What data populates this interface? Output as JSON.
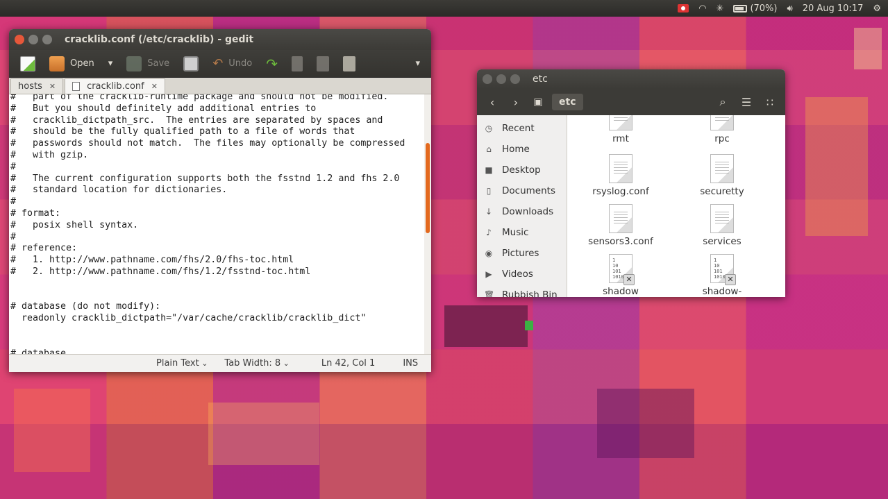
{
  "top_panel": {
    "battery": "(70%)",
    "datetime": "20 Aug 10:17"
  },
  "gedit": {
    "title": "cracklib.conf (/etc/cracklib) - gedit",
    "toolbar": {
      "open_label": "Open",
      "save_label": "Save",
      "undo_label": "Undo"
    },
    "tabs": [
      {
        "label": "hosts"
      },
      {
        "label": "cracklib.conf"
      }
    ],
    "lines": [
      "#   part of the cracklib-runtime package and should not be modified.",
      "#   But you should definitely add additional entries to",
      "#   cracklib_dictpath_src.  The entries are separated by spaces and",
      "#   should be the fully qualified path to a file of words that",
      "#   passwords should not match.  The files may optionally be compressed",
      "#   with gzip.",
      "#",
      "#   The current configuration supports both the fsstnd 1.2 and fhs 2.0",
      "#   standard location for dictionaries.",
      "#",
      "# format:",
      "#   posix shell syntax.",
      "#",
      "# reference:",
      "#   1. http://www.pathname.com/fhs/2.0/fhs-toc.html",
      "#   2. http://www.pathname.com/fhs/1.2/fsstnd-toc.html",
      "",
      "",
      "# database (do not modify):",
      "  readonly cracklib_dictpath=\"/var/cache/cracklib/cracklib_dict\"",
      "",
      "",
      "# database ..."
    ],
    "status": {
      "language": "Plain Text",
      "tab_width": "Tab Width: 8",
      "position": "Ln 42, Col 1",
      "mode": "INS"
    }
  },
  "files": {
    "title": "etc",
    "breadcrumb": "etc",
    "sidebar": [
      {
        "label": "Recent",
        "icon": "clock-icon"
      },
      {
        "label": "Home",
        "icon": "home-icon"
      },
      {
        "label": "Desktop",
        "icon": "desktop-icon"
      },
      {
        "label": "Documents",
        "icon": "document-icon"
      },
      {
        "label": "Downloads",
        "icon": "download-icon"
      },
      {
        "label": "Music",
        "icon": "music-icon"
      },
      {
        "label": "Pictures",
        "icon": "camera-icon"
      },
      {
        "label": "Videos",
        "icon": "video-icon"
      },
      {
        "label": "Rubbish Bin",
        "icon": "trash-icon"
      }
    ],
    "items": [
      {
        "label": "rmt",
        "kind": "text"
      },
      {
        "label": "rpc",
        "kind": "text"
      },
      {
        "label": "rsyslog.conf",
        "kind": "text"
      },
      {
        "label": "securetty",
        "kind": "text"
      },
      {
        "label": "sensors3.conf",
        "kind": "text"
      },
      {
        "label": "services",
        "kind": "text"
      },
      {
        "label": "shadow",
        "kind": "binary"
      },
      {
        "label": "shadow-",
        "kind": "binary"
      }
    ]
  }
}
